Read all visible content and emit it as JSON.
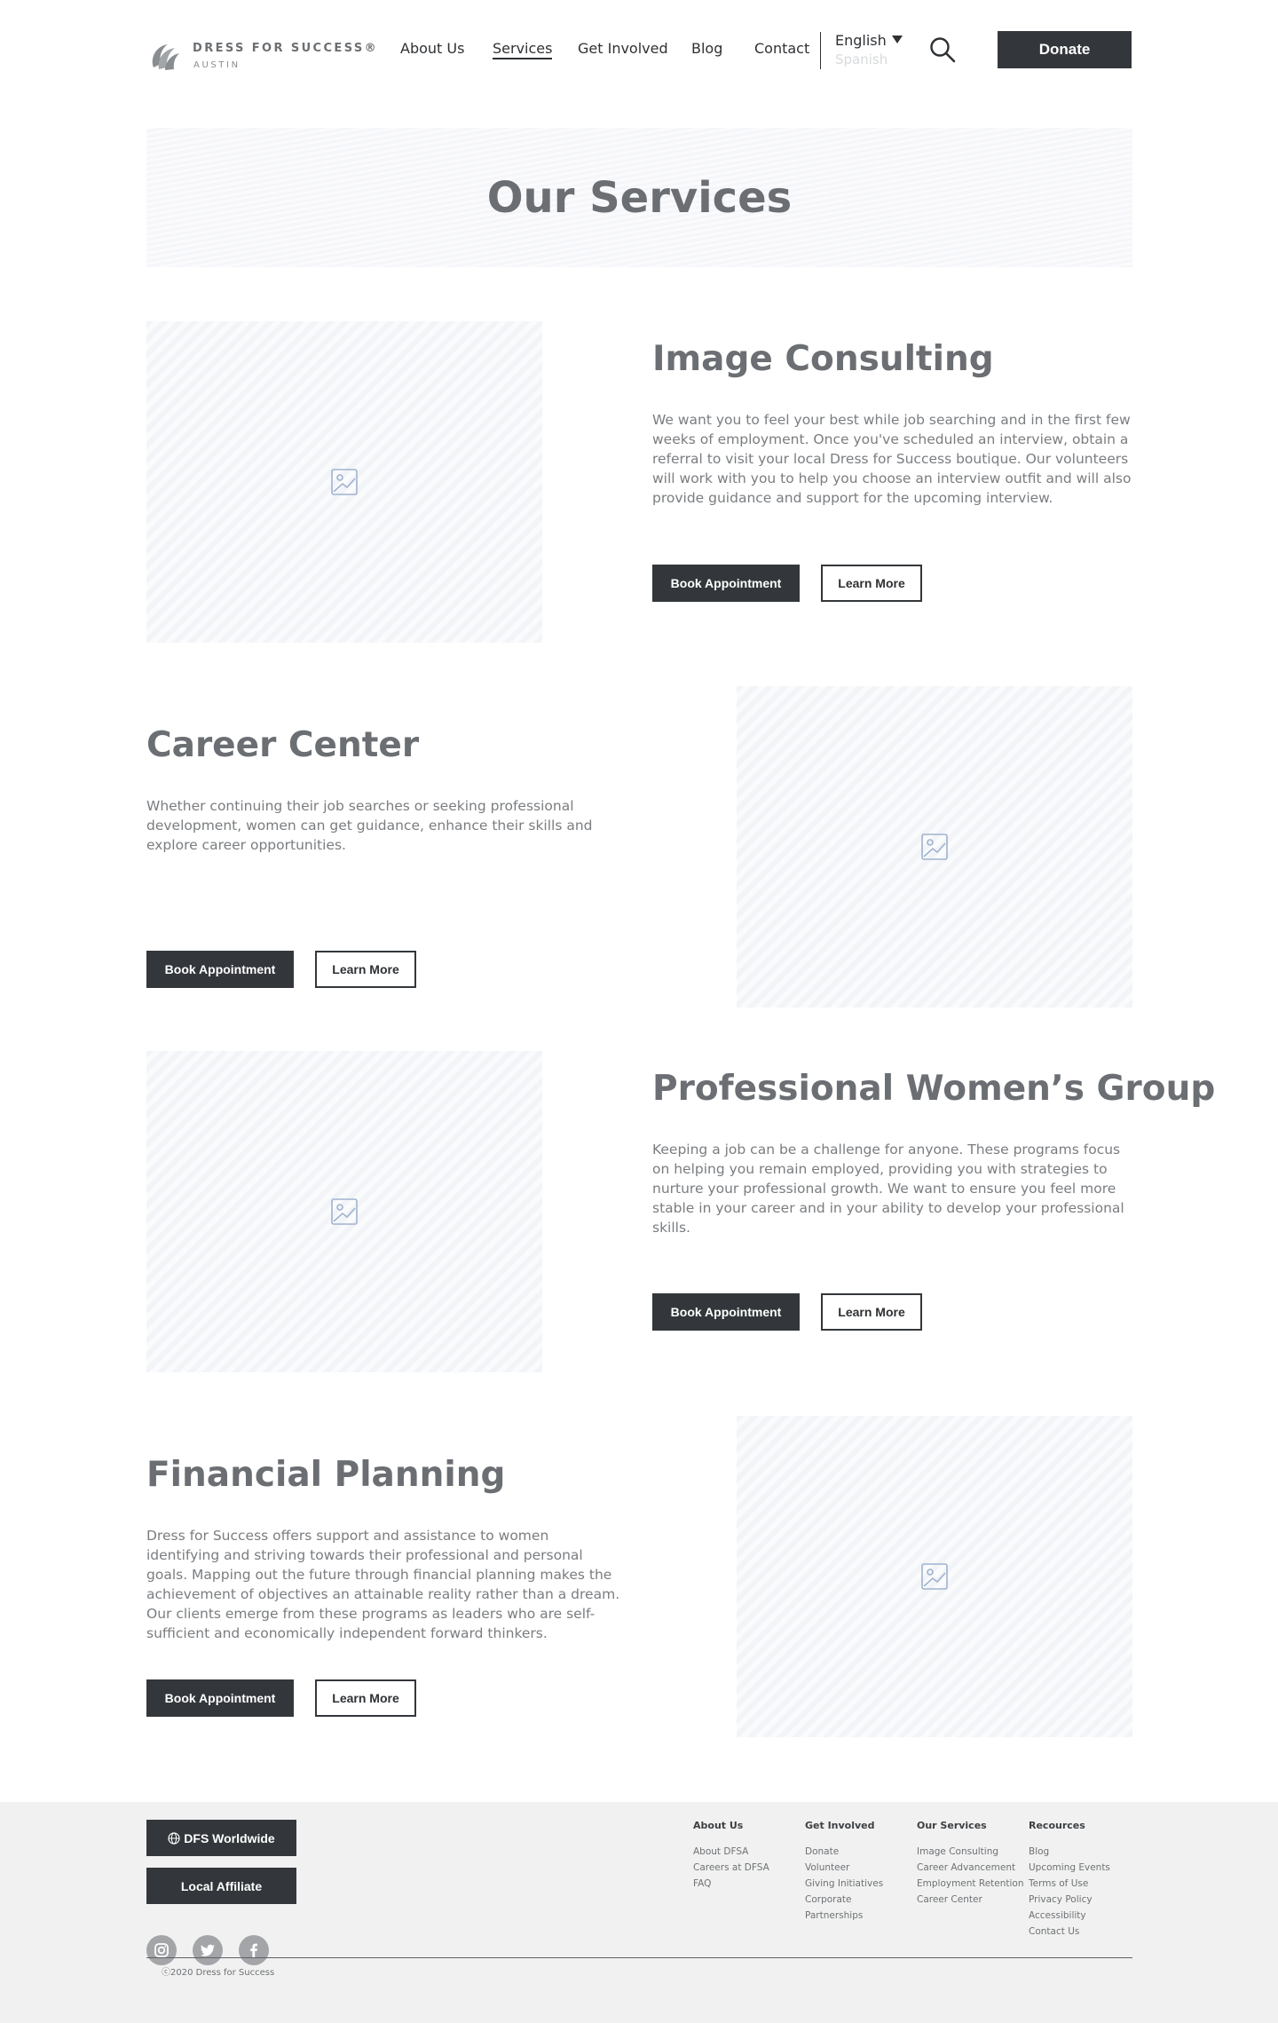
{
  "header": {
    "logo": {
      "name": "DRESS FOR SUCCESS®",
      "city": "AUSTIN"
    },
    "nav": [
      {
        "label": "About Us"
      },
      {
        "label": "Services",
        "active": true
      },
      {
        "label": "Get Involved"
      },
      {
        "label": "Blog"
      },
      {
        "label": "Contact"
      }
    ],
    "language": {
      "selected": "English",
      "alternate": "Spanish"
    },
    "donate_label": "Donate"
  },
  "hero": {
    "title": "Our Services"
  },
  "services": [
    {
      "title": "Image Consulting",
      "text": "We want you to feel your best while job searching and in the first few weeks of employment. Once you've scheduled an interview, obtain a referral to visit your local Dress for Success boutique. Our volunteers will work with you to help you choose an interview outfit and will also provide guidance and support for the upcoming interview.",
      "book_label": "Book Appointment",
      "learn_label": "Learn More"
    },
    {
      "title": "Career Center",
      "text": "Whether continuing their job searches or seeking professional development, women can get guidance, enhance their skills and explore career opportunities.",
      "book_label": "Book Appointment",
      "learn_label": "Learn More"
    },
    {
      "title": "Professional Women’s Group",
      "text": "Keeping a job can be a challenge for anyone. These programs focus on helping you remain employed, providing you with strategies to nurture your professional growth. We want to ensure you feel more stable in your career and in your ability to develop your professional skills.",
      "book_label": "Book Appointment",
      "learn_label": "Learn More"
    },
    {
      "title": "Financial Planning",
      "text": "Dress for Success offers support and assistance to women identifying and striving towards their professional and personal goals. Mapping out the future through financial planning makes the achievement of objectives an attainable reality rather than a dream. Our clients emerge from these programs as leaders who are self-sufficient and economically independent forward thinkers.",
      "book_label": "Book Appointment",
      "learn_label": "Learn More"
    }
  ],
  "footer": {
    "worldwide_label": "DFS Worldwide",
    "affiliate_label": "Local Affiliate",
    "columns": [
      {
        "heading": "About Us",
        "links": [
          "About DFSA",
          "Careers at DFSA",
          "FAQ"
        ]
      },
      {
        "heading": "Get Involved",
        "links": [
          "Donate",
          "Volunteer",
          "Giving Initiatives",
          "Corporate",
          "Partnerships"
        ]
      },
      {
        "heading": "Our Services",
        "links": [
          "Image Consulting",
          "Career Advancement",
          "Employment Retention",
          "Career Center"
        ]
      },
      {
        "heading": "Recources",
        "links": [
          "Blog",
          "Upcoming Events",
          "Terms of Use",
          "Privacy Policy",
          "Accessibility",
          "Contact Us"
        ]
      }
    ],
    "copyright": "ⓒ2020 Dress for Success"
  },
  "icons": {
    "logo": "swirl-logo-icon",
    "search": "search-icon",
    "image_placeholder": "image-icon",
    "worldwide": "globe-icon",
    "social": [
      "instagram-icon",
      "twitter-icon",
      "facebook-icon"
    ]
  },
  "colors": {
    "dark_button": "#33373b",
    "heading_gray": "#6b6e72",
    "footer_bg": "#f1f1f1",
    "placeholder_icon": "#9fb3cf"
  }
}
